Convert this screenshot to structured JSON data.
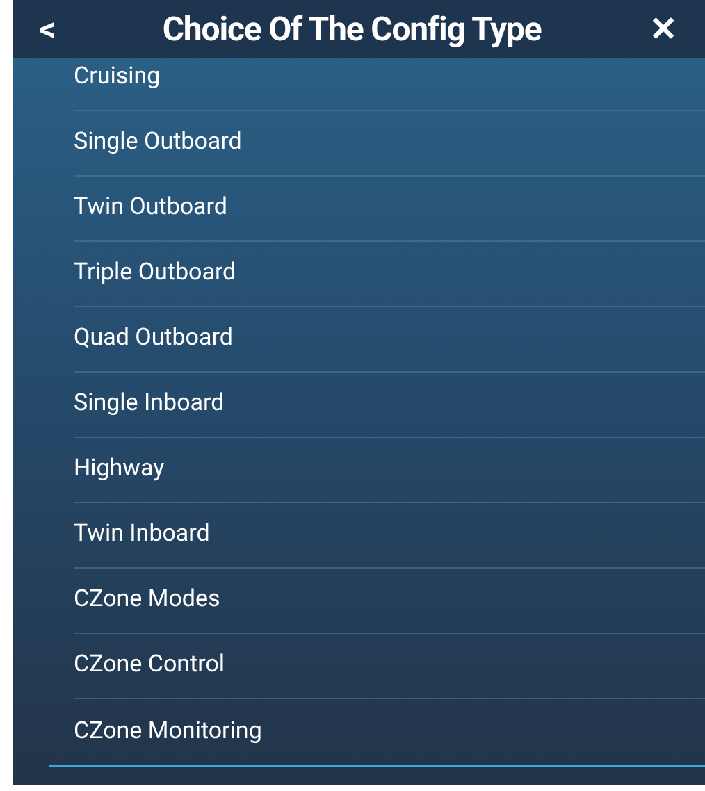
{
  "header": {
    "back": "<",
    "title": "Choice Of The Config Type",
    "close": "✕"
  },
  "items": [
    {
      "label": "Cruising"
    },
    {
      "label": "Single Outboard"
    },
    {
      "label": "Twin Outboard"
    },
    {
      "label": "Triple Outboard"
    },
    {
      "label": "Quad Outboard"
    },
    {
      "label": "Single Inboard"
    },
    {
      "label": "Highway"
    },
    {
      "label": "Twin Inboard"
    },
    {
      "label": "CZone Modes"
    },
    {
      "label": "CZone Control"
    },
    {
      "label": "CZone Monitoring"
    }
  ]
}
